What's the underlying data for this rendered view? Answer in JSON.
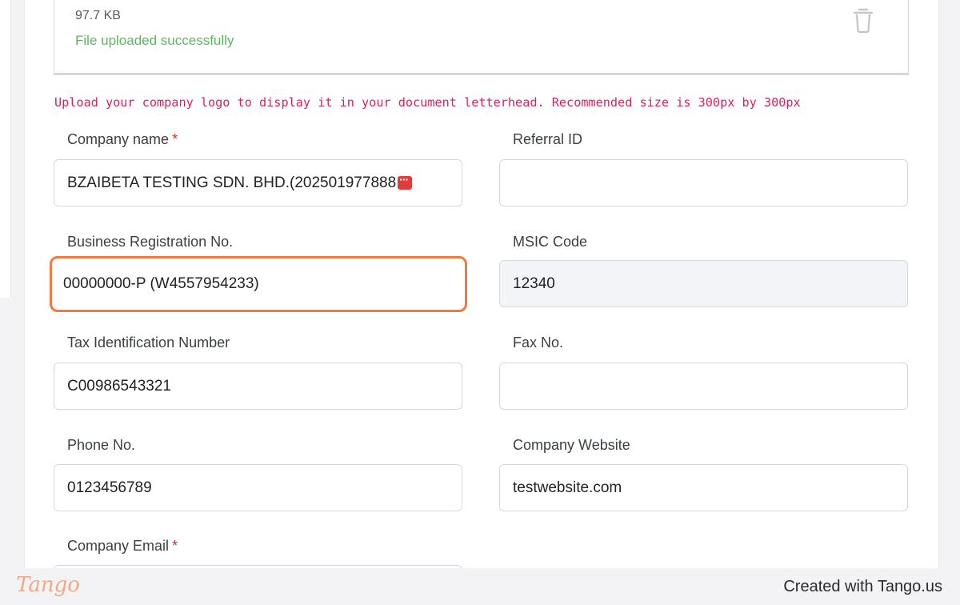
{
  "upload": {
    "file_size": "97.7 KB",
    "status": "File uploaded successfully",
    "delete_icon": "trash-icon"
  },
  "hint": "Upload your company logo to display it in your document letterhead. Recommended size is 300px by 300px",
  "form": {
    "company_name": {
      "label": "Company name",
      "required_mark": "*",
      "value": "BZAIBETA TESTING SDN. BHD.(202501977888"
    },
    "referral_id": {
      "label": "Referral ID",
      "value": ""
    },
    "business_reg": {
      "label": "Business Registration No.",
      "value": "00000000-P (W4557954233)"
    },
    "msic_code": {
      "label": "MSIC Code",
      "value": "12340"
    },
    "tax_id": {
      "label": "Tax Identification Number",
      "value": "C00986543321"
    },
    "fax": {
      "label": "Fax No.",
      "value": ""
    },
    "phone": {
      "label": "Phone No.",
      "value": "0123456789"
    },
    "website": {
      "label": "Company Website",
      "value": "testwebsite.com"
    },
    "email": {
      "label": "Company Email",
      "required_mark": "*",
      "value": ""
    }
  },
  "footer": {
    "logo": "Tango",
    "credit": "Created with Tango.us"
  },
  "colors": {
    "success": "#5cb85c",
    "hint": "#e01e5a",
    "highlight": "#f07a3f",
    "required": "#d32f2f"
  }
}
